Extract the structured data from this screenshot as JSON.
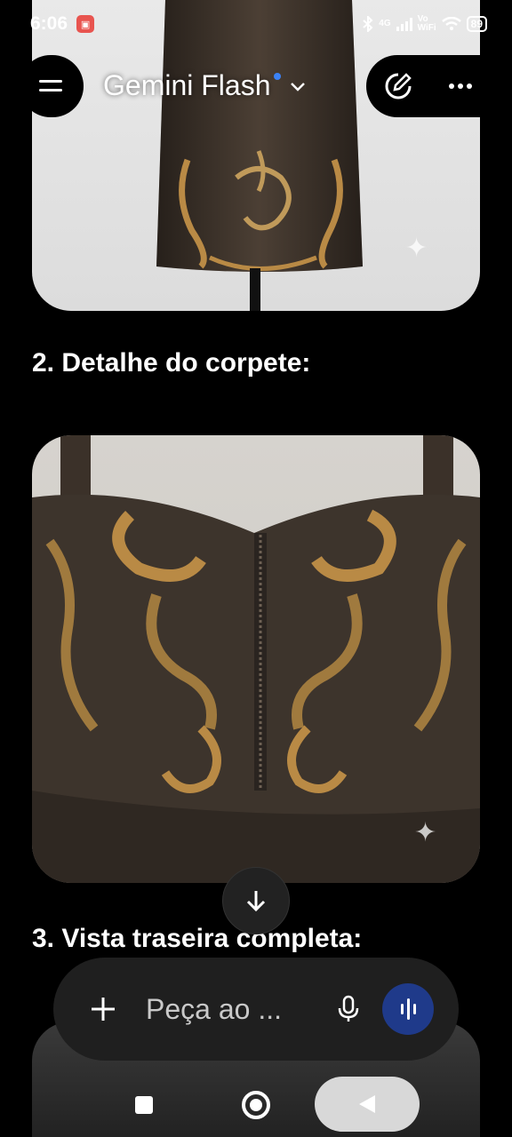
{
  "status_bar": {
    "time": "6:06",
    "network": "4G",
    "volte_top": "Vo",
    "volte_bottom": "WiFi",
    "battery": "89"
  },
  "app_bar": {
    "title": "Gemini Flash",
    "menu_icon": "hamburger-menu-icon",
    "dropdown_icon": "chevron-down-icon",
    "new_chat_icon": "edit-icon",
    "more_icon": "more-horiz-icon"
  },
  "content": {
    "heading_2": "2. Detalhe do corpete:",
    "heading_3": "3. Vista traseira completa:"
  },
  "input": {
    "placeholder": "Peça ao ..."
  },
  "colors": {
    "accent_blue": "#1f3a8a",
    "dot_blue": "#3b82f6",
    "leather": "#3b3129",
    "sequin_gold": "#b98a45"
  }
}
